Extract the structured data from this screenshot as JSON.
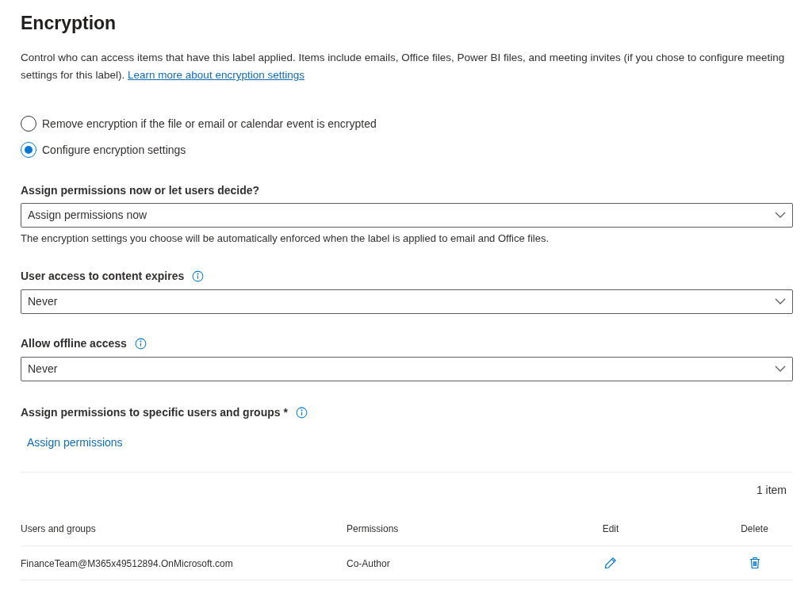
{
  "title": "Encryption",
  "description": {
    "text": "Control who can access items that have this label applied. Items include emails, Office files, Power BI files, and meeting invites (if you chose to configure meeting settings for this label). ",
    "link": "Learn more about encryption settings"
  },
  "radios": [
    {
      "label": "Remove encryption if the file or email or calendar event is encrypted",
      "selected": false
    },
    {
      "label": "Configure encryption settings",
      "selected": true
    }
  ],
  "fields": [
    {
      "label": "Assign permissions now or let users decide?",
      "info": false,
      "value": "Assign permissions now",
      "help": "The encryption settings you choose will be automatically enforced when the label is applied to email and Office files."
    },
    {
      "label": "User access to content expires",
      "info": true,
      "value": "Never"
    },
    {
      "label": "Allow offline access",
      "info": true,
      "value": "Never"
    }
  ],
  "assign": {
    "label": "Assign permissions to specific users and groups *",
    "info": true,
    "link": "Assign permissions"
  },
  "table": {
    "count": "1 item",
    "columns": [
      "Users and groups",
      "Permissions",
      "Edit",
      "Delete"
    ],
    "rows": [
      {
        "user": "FinanceTeam@M365x49512894.OnMicrosoft.com",
        "permission": "Co-Author"
      }
    ]
  }
}
